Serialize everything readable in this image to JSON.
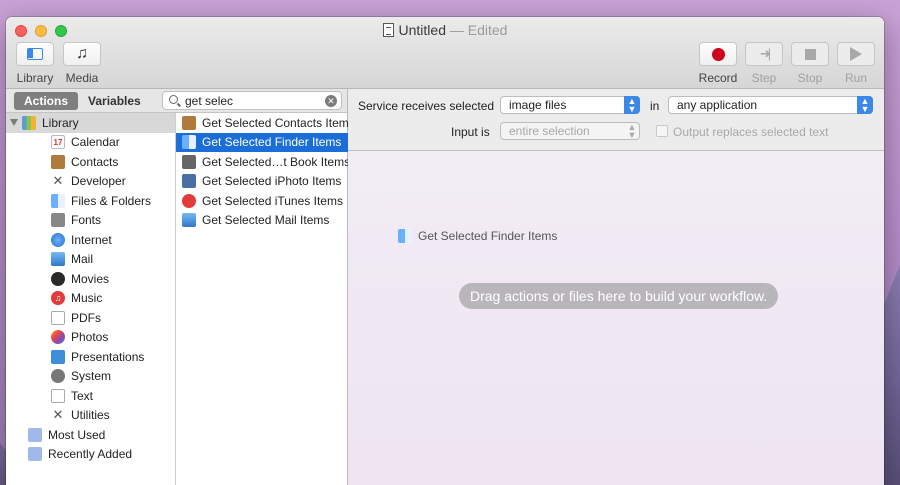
{
  "window": {
    "title": "Untitled",
    "title_status": "— Edited"
  },
  "toolbar": {
    "library_label": "Library",
    "media_label": "Media",
    "record_label": "Record",
    "step_label": "Step",
    "stop_label": "Stop",
    "run_label": "Run"
  },
  "left_header": {
    "actions_tab": "Actions",
    "variables_tab": "Variables",
    "search_value": "get selec"
  },
  "library": {
    "root_label": "Library",
    "items": [
      {
        "label": "Calendar",
        "icon": "calendar-icon",
        "glyph": "17"
      },
      {
        "label": "Contacts",
        "icon": "contacts-icon",
        "glyph": ""
      },
      {
        "label": "Developer",
        "icon": "developer-icon",
        "glyph": "✕"
      },
      {
        "label": "Files & Folders",
        "icon": "finder-icon",
        "glyph": ""
      },
      {
        "label": "Fonts",
        "icon": "fonts-icon",
        "glyph": ""
      },
      {
        "label": "Internet",
        "icon": "internet-icon",
        "glyph": ""
      },
      {
        "label": "Mail",
        "icon": "mail-icon",
        "glyph": ""
      },
      {
        "label": "Movies",
        "icon": "movies-icon",
        "glyph": ""
      },
      {
        "label": "Music",
        "icon": "music-icon",
        "glyph": "♫"
      },
      {
        "label": "PDFs",
        "icon": "pdf-icon",
        "glyph": ""
      },
      {
        "label": "Photos",
        "icon": "photos-icon",
        "glyph": ""
      },
      {
        "label": "Presentations",
        "icon": "presentations-icon",
        "glyph": ""
      },
      {
        "label": "System",
        "icon": "system-icon",
        "glyph": ""
      },
      {
        "label": "Text",
        "icon": "text-icon",
        "glyph": ""
      },
      {
        "label": "Utilities",
        "icon": "utilities-icon",
        "glyph": "✕"
      }
    ],
    "smart_groups": [
      {
        "label": "Most Used",
        "icon": "folder-icon"
      },
      {
        "label": "Recently Added",
        "icon": "folder-icon"
      }
    ]
  },
  "actions": {
    "items": [
      {
        "label": "Get Selected Contacts Items",
        "icon": "contacts-icon",
        "selected": false
      },
      {
        "label": "Get Selected Finder Items",
        "icon": "finder-icon",
        "selected": true
      },
      {
        "label": "Get Selected…t Book Items",
        "icon": "book-icon",
        "selected": false
      },
      {
        "label": "Get Selected iPhoto Items",
        "icon": "iphoto-icon",
        "selected": false
      },
      {
        "label": "Get Selected iTunes Items",
        "icon": "itunes-icon",
        "selected": false
      },
      {
        "label": "Get Selected Mail Items",
        "icon": "mail-icon",
        "selected": false
      }
    ]
  },
  "service": {
    "receives_label": "Service receives selected",
    "receives_value": "image files",
    "in_label": "in",
    "in_value": "any application",
    "input_label": "Input is",
    "input_value": "entire selection",
    "output_replaces_label": "Output replaces selected text"
  },
  "workflow": {
    "item_label": "Get Selected Finder Items",
    "drag_hint": "Drag actions or files here to build your workflow."
  },
  "colors": {
    "accent": "#1b6ed8",
    "record": "#d0021b"
  }
}
